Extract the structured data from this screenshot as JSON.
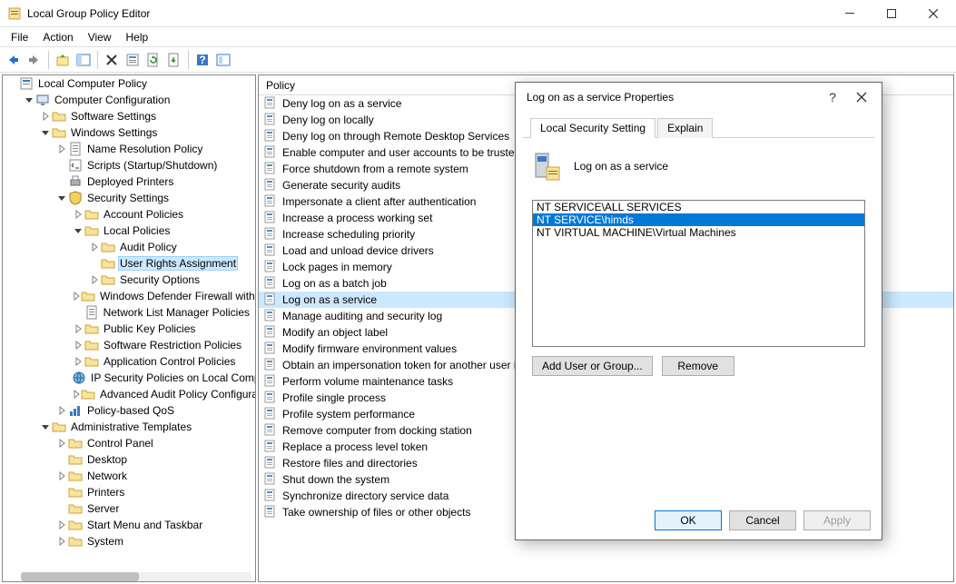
{
  "window": {
    "title": "Local Group Policy Editor"
  },
  "menu": {
    "file": "File",
    "action": "Action",
    "view": "View",
    "help": "Help"
  },
  "tree": {
    "root": "Local Computer Policy",
    "cc": "Computer Configuration",
    "ss": "Software Settings",
    "ws": "Windows Settings",
    "nrp": "Name Resolution Policy",
    "scr": "Scripts (Startup/Shutdown)",
    "dp": "Deployed Printers",
    "sec": "Security Settings",
    "ap": "Account Policies",
    "lp": "Local Policies",
    "aud": "Audit Policy",
    "ura": "User Rights Assignment",
    "so": "Security Options",
    "wdf": "Windows Defender Firewall with Advanced Security",
    "nlm": "Network List Manager Policies",
    "pkp": "Public Key Policies",
    "srp": "Software Restriction Policies",
    "acp": "Application Control Policies",
    "ips": "IP Security Policies on Local Computer",
    "aap": "Advanced Audit Policy Configuration",
    "qos": "Policy-based QoS",
    "at": "Administrative Templates",
    "cp": "Control Panel",
    "dk": "Desktop",
    "nw": "Network",
    "pr": "Printers",
    "sv": "Server",
    "smt": "Start Menu and Taskbar",
    "sys": "System"
  },
  "list": {
    "header": "Policy",
    "items": [
      "Deny log on as a service",
      "Deny log on locally",
      "Deny log on through Remote Desktop Services",
      "Enable computer and user accounts to be trusted for delegation",
      "Force shutdown from a remote system",
      "Generate security audits",
      "Impersonate a client after authentication",
      "Increase a process working set",
      "Increase scheduling priority",
      "Load and unload device drivers",
      "Lock pages in memory",
      "Log on as a batch job",
      "Log on as a service",
      "Manage auditing and security log",
      "Modify an object label",
      "Modify firmware environment values",
      "Obtain an impersonation token for another user in the same session",
      "Perform volume maintenance tasks",
      "Profile single process",
      "Profile system performance",
      "Remove computer from docking station",
      "Replace a process level token",
      "Restore files and directories",
      "Shut down the system",
      "Synchronize directory service data",
      "Take ownership of files or other objects"
    ],
    "selected_index": 12
  },
  "dialog": {
    "title": "Log on as a service Properties",
    "tab1": "Local Security Setting",
    "tab2": "Explain",
    "policy_name": "Log on as a service",
    "entries": [
      "NT SERVICE\\ALL SERVICES",
      "NT SERVICE\\himds",
      "NT VIRTUAL MACHINE\\Virtual Machines"
    ],
    "selected_entry_index": 1,
    "add_btn": "Add User or Group...",
    "remove_btn": "Remove",
    "ok": "OK",
    "cancel": "Cancel",
    "apply": "Apply"
  }
}
